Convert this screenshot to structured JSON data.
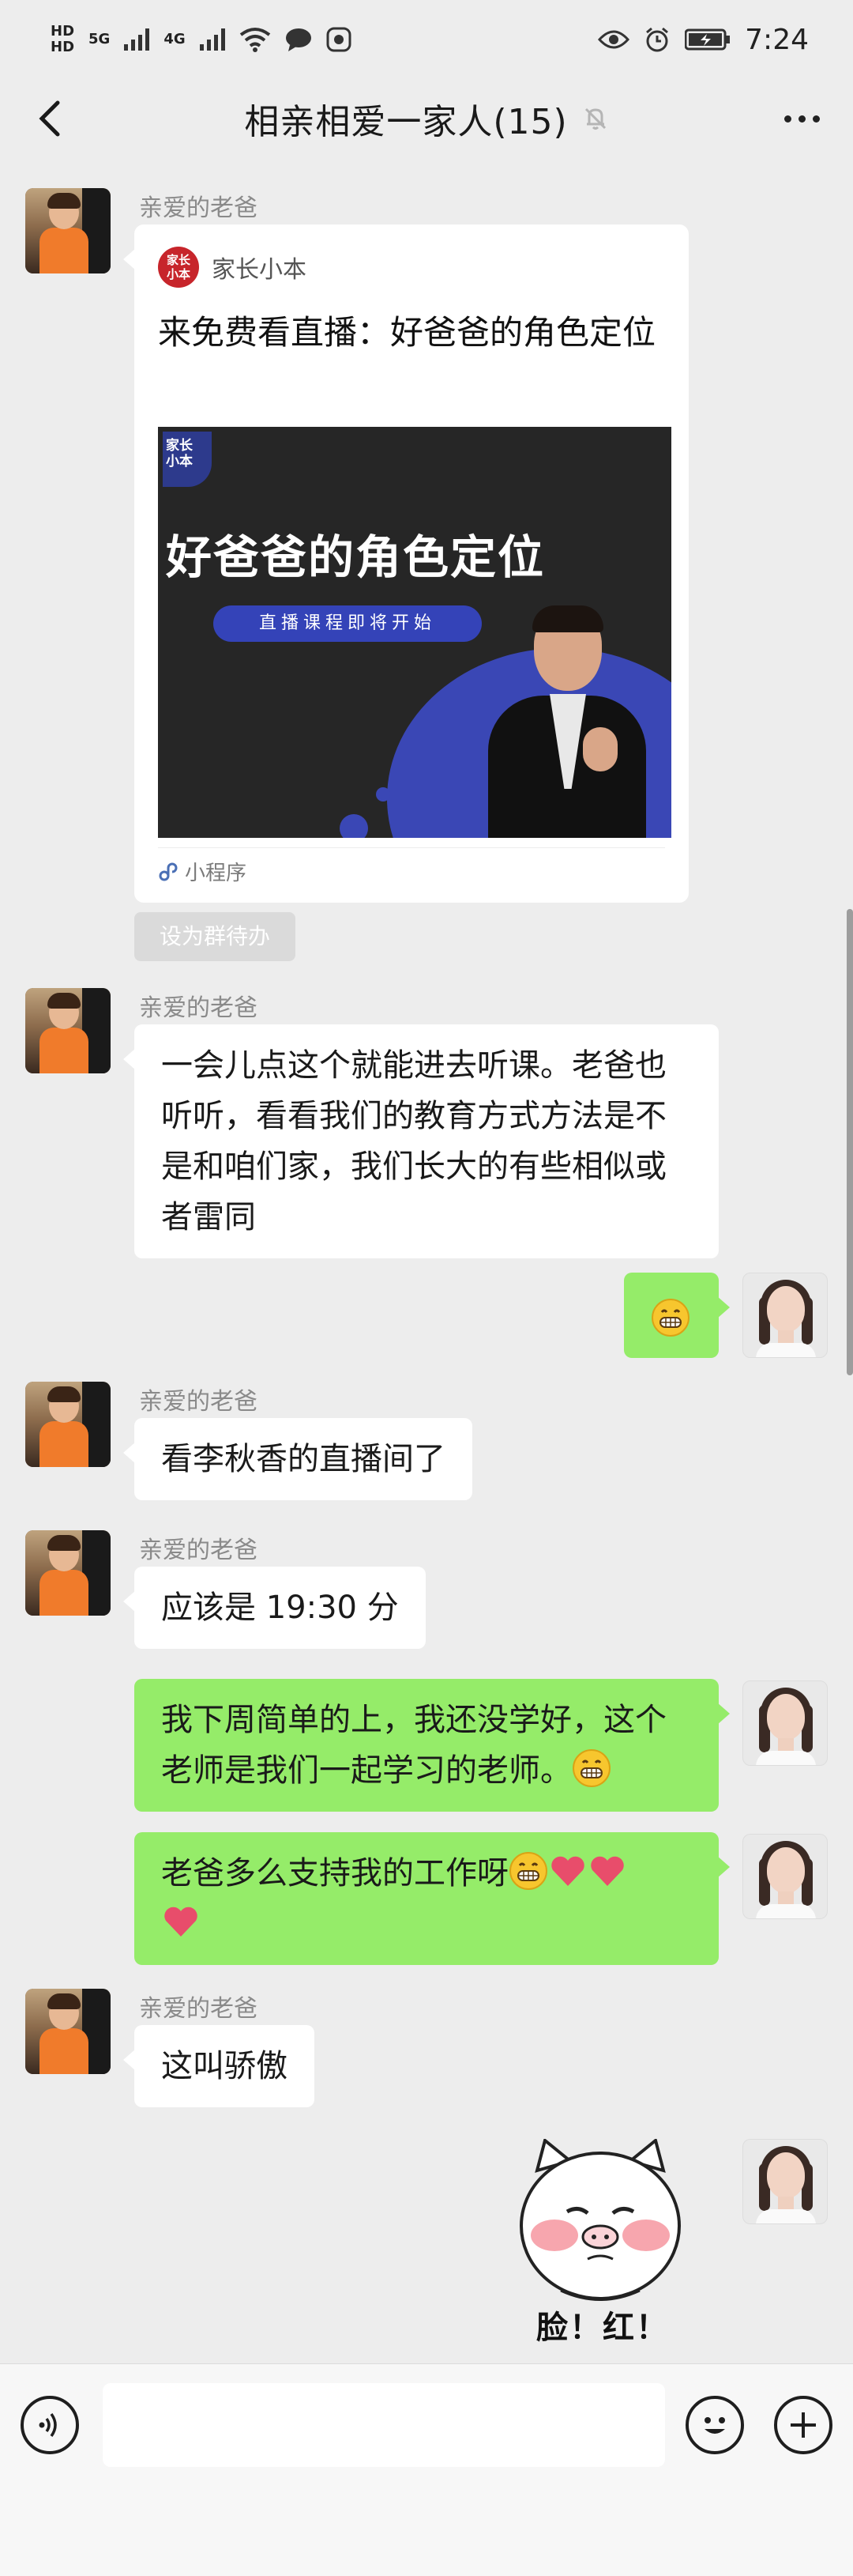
{
  "status_bar": {
    "hd1": "HD",
    "hd2": "HD",
    "net1": "5G",
    "net2": "4G",
    "time": "7:24"
  },
  "nav": {
    "title": "相亲相爱一家人(15)"
  },
  "messages": {
    "m1": {
      "sender": "亲爱的老爸",
      "card": {
        "source": "家长小本",
        "logo_text": "家长\n小本",
        "title": "来免费看直播：好爸爸的角色定位",
        "image_title": "好爸爸的角色定位",
        "image_subtitle": "直播课程即将开始",
        "footer": "小程序"
      },
      "todo_button": "设为群待办"
    },
    "m2": {
      "sender": "亲爱的老爸",
      "text": "一会儿点这个就能进去听课。老爸也听听，看看我们的教育方式方法是不是和咱们家，我们长大的有些相似或者雷同"
    },
    "m3": {
      "emoji": "grin-emoji"
    },
    "m4": {
      "sender": "亲爱的老爸",
      "text": "看李秋香的直播间了"
    },
    "m5": {
      "sender": "亲爱的老爸",
      "text": "应该是 19:30 分"
    },
    "m6": {
      "text": "我下周简单的上，我还没学好，这个老师是我们一起学习的老师。"
    },
    "m7": {
      "text": "老爸多么支持我的工作呀"
    },
    "m8": {
      "sender": "亲爱的老爸",
      "text": "这叫骄傲"
    },
    "m9": {
      "sticker_text": "脸！红！"
    }
  },
  "input_bar": {
    "placeholder": ""
  },
  "colors": {
    "background": "#ededed",
    "bubble_in": "#ffffff",
    "bubble_out": "#95ec69",
    "brand_red": "#c7252b",
    "card_blue": "#3443b8"
  }
}
